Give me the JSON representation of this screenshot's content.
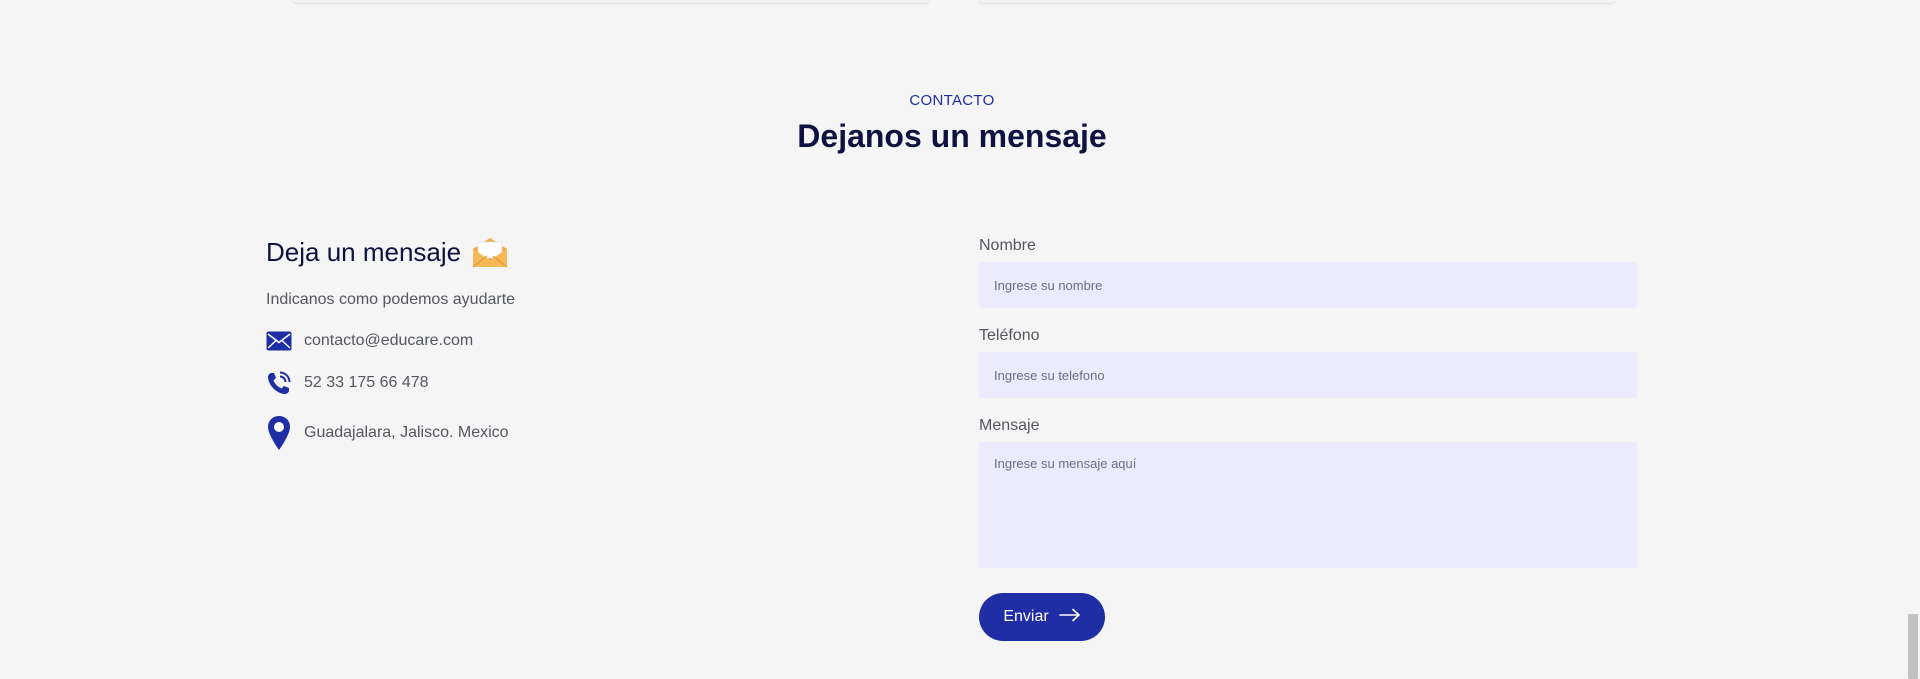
{
  "section": {
    "eyebrow": "CONTACTO",
    "title": "Dejanos un mensaje"
  },
  "info": {
    "title": "Deja un mensaje",
    "title_icon": "envelope-emoji-icon",
    "subtitle": "Indicanos como podemos ayudarte",
    "email": "contacto@educare.com",
    "phone": "52 33 175 66 478",
    "location": "Guadajalara, Jalisco. Mexico"
  },
  "form": {
    "name_label": "Nombre",
    "name_placeholder": "Ingrese su nombre",
    "phone_label": "Teléfono",
    "phone_placeholder": "Ingrese su telefono",
    "message_label": "Mensaje",
    "message_placeholder": "Ingrese su mensaje aquí",
    "submit_label": "Enviar"
  },
  "colors": {
    "accent": "#1f2ea5",
    "heading": "#0d1240",
    "input_bg": "#ebebfd",
    "page_bg": "#f5f5f5"
  }
}
